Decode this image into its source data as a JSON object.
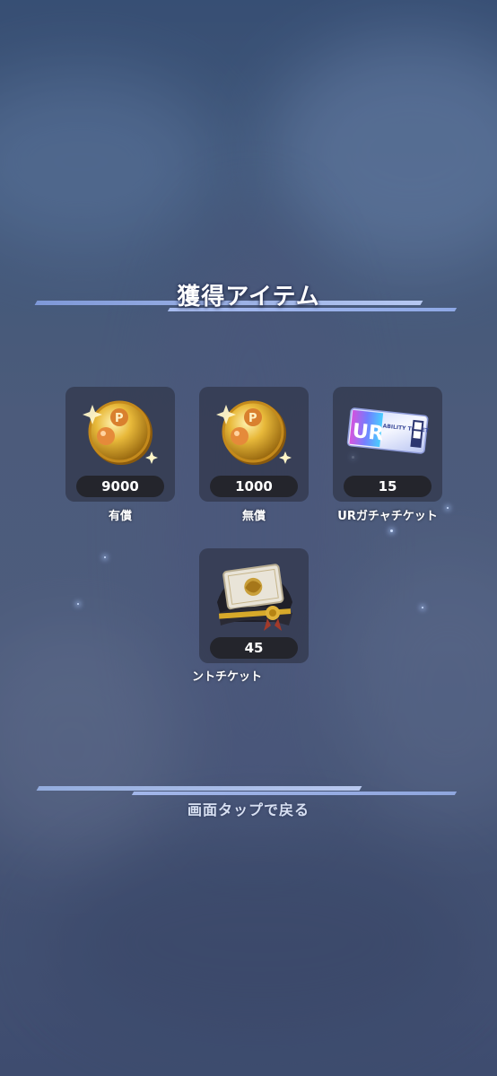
{
  "title": "獲得アイテム",
  "items": [
    {
      "name": "有償",
      "quantity": "9000",
      "icon": "gold-coin-icon"
    },
    {
      "name": "無償",
      "quantity": "1000",
      "icon": "gold-coin-icon"
    },
    {
      "name": "URガチャチケット",
      "quantity": "15",
      "icon": "ur-gacha-ticket-icon",
      "ticket_text": "UR",
      "ticket_sub": "ABILITY TICKET"
    },
    {
      "name": "ントチケット",
      "quantity": "45",
      "icon": "event-ticket-icon"
    }
  ],
  "footer": {
    "tap_to_return": "画面タップで戻る"
  },
  "colors": {
    "accent_line": "#8ea8e6",
    "card_bg": "#30364a",
    "qty_bg": "#24252c",
    "coin_gold": "#e2b33a"
  }
}
